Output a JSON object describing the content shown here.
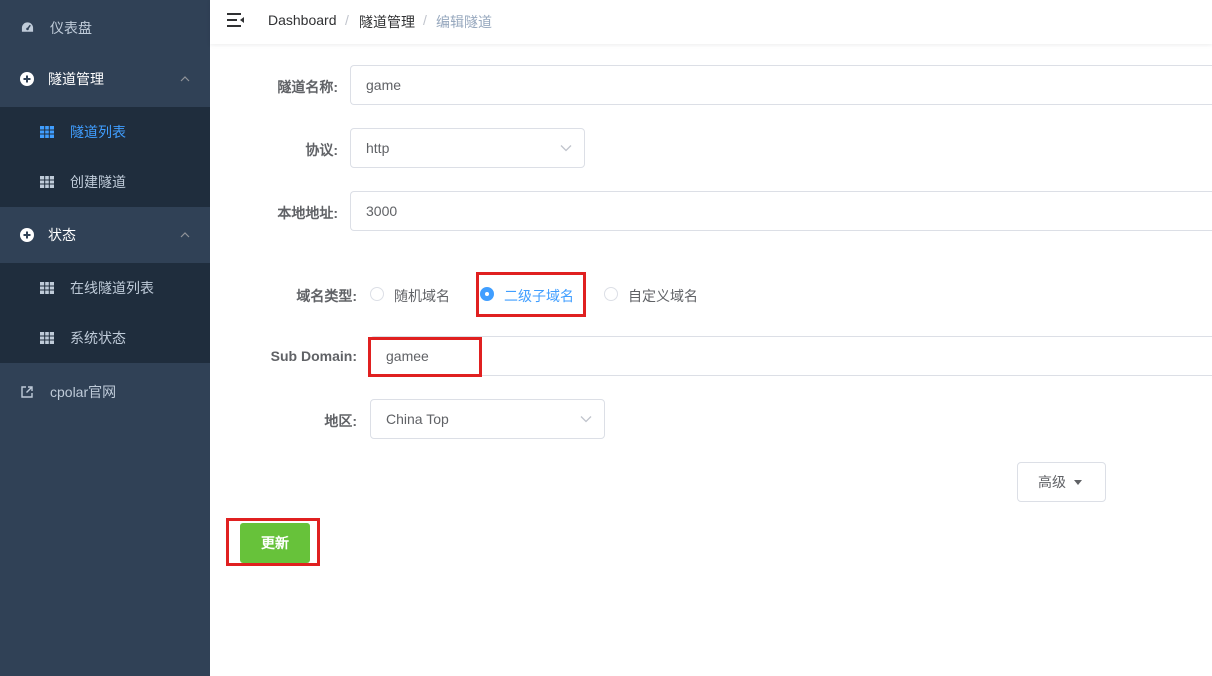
{
  "sidebar": {
    "items": [
      {
        "label": "仪表盘",
        "icon": "dashboard-icon"
      },
      {
        "label": "隧道管理",
        "icon": "plus-circle-icon",
        "children": [
          {
            "label": "隧道列表",
            "icon": "table-icon",
            "active": true
          },
          {
            "label": "创建隧道",
            "icon": "table-icon"
          }
        ]
      },
      {
        "label": "状态",
        "icon": "plus-circle-icon",
        "children": [
          {
            "label": "在线隧道列表",
            "icon": "table-icon"
          },
          {
            "label": "系统状态",
            "icon": "table-icon"
          }
        ]
      },
      {
        "label": "cpolar官网",
        "icon": "external-link-icon"
      }
    ]
  },
  "header": {
    "breadcrumb": [
      "Dashboard",
      "隧道管理",
      "编辑隧道"
    ],
    "separator": "/"
  },
  "form": {
    "tunnel_name": {
      "label": "隧道名称:",
      "value": "game"
    },
    "protocol": {
      "label": "协议:",
      "value": "http"
    },
    "local_address": {
      "label": "本地地址:",
      "value": "3000"
    },
    "domain_type": {
      "label": "域名类型:",
      "options": [
        "随机域名",
        "二级子域名",
        "自定义域名"
      ],
      "selected": "二级子域名"
    },
    "sub_domain": {
      "label": "Sub Domain:",
      "value": "gamee"
    },
    "region": {
      "label": "地区:",
      "value": "China Top"
    }
  },
  "buttons": {
    "advanced": "高级",
    "update": "更新"
  },
  "colors": {
    "sidebar_bg": "#304156",
    "submenu_bg": "#1f2d3d",
    "accent": "#409eff",
    "success": "#67c23a",
    "highlight": "#e02020"
  }
}
